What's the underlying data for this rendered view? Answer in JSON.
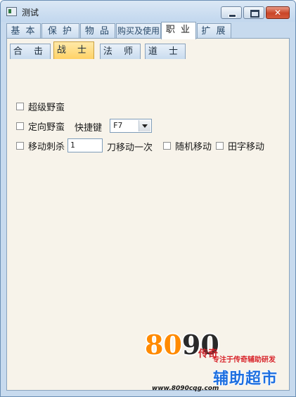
{
  "window": {
    "title": "测试",
    "buttons": {
      "minimize": "minimize",
      "maximize": "maximize",
      "close": "close"
    }
  },
  "top_tabs": [
    {
      "label": "基 本"
    },
    {
      "label": "保 护"
    },
    {
      "label": "物 品"
    },
    {
      "label": "购买及使用"
    },
    {
      "label": "职 业"
    },
    {
      "label": "扩 展"
    }
  ],
  "active_top_tab": "职 业",
  "sub_tabs": [
    {
      "label": "合 击"
    },
    {
      "label": "战 士"
    },
    {
      "label": "法 师"
    },
    {
      "label": "道 士"
    }
  ],
  "active_sub_tab": "战 士",
  "options": {
    "super_barbarian": {
      "label": "超级野蛮",
      "checked": false
    },
    "targeted_barbarian": {
      "label": "定向野蛮",
      "checked": false
    },
    "hotkey_label": "快捷键",
    "hotkey_value": "F7",
    "move_stab": {
      "label": "移动刺杀",
      "checked": false
    },
    "move_stab_value": "1",
    "move_stab_suffix": "刀移动一次",
    "random_move": {
      "label": "随机移动",
      "checked": false
    },
    "tian_move": {
      "label": "田字移动",
      "checked": false
    }
  },
  "watermark": {
    "logo_orange": "80",
    "logo_dark": "90",
    "logo_small": "传奇",
    "slogan": "专注于传奇辅助研发",
    "brand": "辅助超市",
    "url": "www.8090cqg.com"
  },
  "colors": {
    "active_subtab": "#ffd266",
    "panel_bg": "#f7f3ea",
    "frame": "#c7daee",
    "brand_blue": "#1d6fe0",
    "logo_orange": "#ff8a00"
  }
}
